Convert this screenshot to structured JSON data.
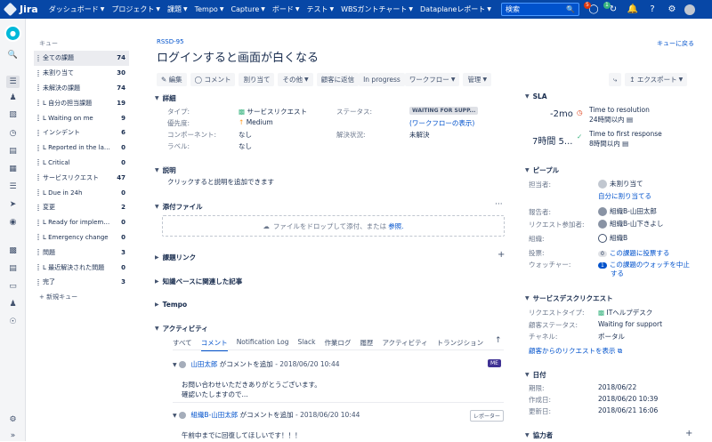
{
  "topbar": {
    "logo": "Jira",
    "nav": [
      "ダッシュボード",
      "プロジェクト",
      "課題",
      "Tempo",
      "Capture",
      "ボード",
      "テスト",
      "WBSガントチャート",
      "Dataplaneレポート"
    ],
    "search_placeholder": "検索",
    "notif_count_red": "5",
    "notif_count_green": "1"
  },
  "queues": {
    "header": "キュー",
    "items": [
      {
        "label": "全ての課題",
        "count": "74",
        "selected": true
      },
      {
        "label": "未割り当て",
        "count": "30"
      },
      {
        "label": "未解決の課題",
        "count": "74"
      },
      {
        "label": "L 自分の担当課題",
        "count": "19"
      },
      {
        "label": "  L Waiting on me",
        "count": "9"
      },
      {
        "label": "インシデント",
        "count": "6"
      },
      {
        "label": "L Reported in the las...",
        "count": "0"
      },
      {
        "label": "L Critical",
        "count": "0"
      },
      {
        "label": "サービスリクエスト",
        "count": "47"
      },
      {
        "label": "L Due in 24h",
        "count": "0"
      },
      {
        "label": "変更",
        "count": "2"
      },
      {
        "label": "L Ready for impleme...",
        "count": "0"
      },
      {
        "label": "L Emergency change",
        "count": "0"
      },
      {
        "label": "問題",
        "count": "3"
      },
      {
        "label": "L 最近解決された問題",
        "count": "0"
      },
      {
        "label": "完了",
        "count": "3"
      }
    ],
    "new_queue": "新規キュー"
  },
  "issue": {
    "key": "RSSD-95",
    "back": "キューに戻る",
    "title": "ログインすると画面が白くなる",
    "toolbar": [
      "編集",
      "コメント",
      "割り当て",
      "その他",
      "顧客に返信",
      "In progress",
      "ワークフロー",
      "管理"
    ],
    "share": "",
    "export": "エクスポート"
  },
  "details": {
    "section": "詳細",
    "type_label": "タイプ:",
    "type_value": "サービスリクエスト",
    "priority_label": "優先度:",
    "priority_value": "Medium",
    "component_label": "コンポーネント:",
    "component_value": "なし",
    "labels_label": "ラベル:",
    "labels_value": "なし",
    "status_label": "ステータス:",
    "status_value": "WAITING FOR SUPP...",
    "workflow_link": "(ワークフローの表示)",
    "resolution_label": "解決状況:",
    "resolution_value": "未解決"
  },
  "description": {
    "section": "説明",
    "placeholder": "クリックすると説明を追加できます"
  },
  "attachments": {
    "section": "添付ファイル",
    "drop_text": "ファイルをドロップして添付、または",
    "browse": "参照."
  },
  "issue_links": {
    "section": "課題リンク"
  },
  "kb": {
    "section": "知識ベースに関連した記事"
  },
  "tempo": {
    "section": "Tempo"
  },
  "activity": {
    "section": "アクティビティ",
    "tabs": [
      "すべて",
      "コメント",
      "Notification Log",
      "Slack",
      "作業ログ",
      "履歴",
      "アクティビティ",
      "トランジション"
    ],
    "comments": [
      {
        "author": "山田太郎",
        "action": "がコメントを追加",
        "date": "- 2018/06/20 10:44",
        "tag": "ME",
        "body1": "お問い合わせいただきありがとうございます。",
        "body2": "確認いたしますので..."
      },
      {
        "author": "組織B-山田太郎",
        "action": "がコメントを追加",
        "date": "- 2018/06/20 10:44",
        "tag": "レポーター",
        "body1": "午前中までに回復してほしいです！！！"
      }
    ]
  },
  "sla": {
    "section": "SLA",
    "items": [
      {
        "time": "-2mo",
        "name": "Time to resolution",
        "goal": "24時間以内"
      },
      {
        "time": "7時間 5...",
        "name": "Time to first response",
        "goal": "8時間以内"
      }
    ]
  },
  "people": {
    "section": "ピープル",
    "assignee_label": "担当者:",
    "assignee_value": "未割り当て",
    "assign_me": "自分に割り当てる",
    "reporter_label": "報告者:",
    "reporter_value": "組織B-山田太郎",
    "participants_label": "リクエスト参加者:",
    "participants_value": "組織B-山下きよし",
    "org_label": "組織:",
    "org_value": "組織B",
    "votes_label": "投票:",
    "votes_count": "0",
    "votes_link": "この課題に投票する",
    "watchers_label": "ウォッチャー:",
    "watchers_count": "1",
    "watchers_link1": "この課題のウォッチを中止",
    "watchers_link2": "する"
  },
  "sd_request": {
    "section": "サービスデスクリクエスト",
    "type_label": "リクエストタイプ:",
    "type_value": "ITヘルプデスク",
    "status_label": "顧客ステータス:",
    "status_value": "Waiting for support",
    "channel_label": "チャネル:",
    "channel_value": "ポータル",
    "view_link": "顧客からのリクエストを表示"
  },
  "dates": {
    "section": "日付",
    "due_label": "期限:",
    "due_value": "2018/06/22",
    "created_label": "作成日:",
    "created_value": "2018/06/20 10:39",
    "updated_label": "更新日:",
    "updated_value": "2018/06/21 16:06"
  },
  "collaborators": {
    "section": "協力者"
  },
  "colors": {
    "topbar": "#0747a6",
    "link": "#0052cc"
  }
}
